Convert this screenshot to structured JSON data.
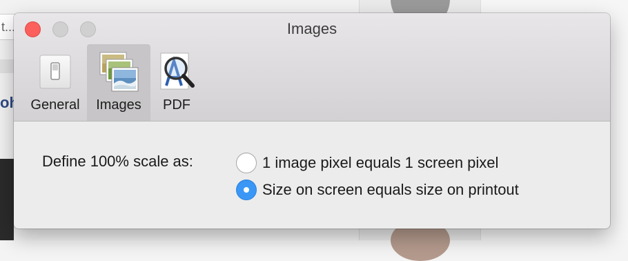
{
  "background": {
    "field_text": "t...",
    "partial_text": "oh"
  },
  "window": {
    "title": "Images",
    "traffic_lights": [
      "close",
      "minimize",
      "zoom"
    ]
  },
  "toolbar": {
    "items": [
      {
        "label": "General",
        "icon": "general-switch-icon",
        "selected": false
      },
      {
        "label": "Images",
        "icon": "images-stack-icon",
        "selected": true
      },
      {
        "label": "PDF",
        "icon": "pdf-magnifier-icon",
        "selected": false
      }
    ]
  },
  "settings": {
    "scale_label": "Define 100% scale as:",
    "options": [
      {
        "label": "1 image pixel equals 1 screen pixel",
        "checked": false
      },
      {
        "label": "Size on screen equals size on printout",
        "checked": true
      }
    ]
  },
  "colors": {
    "accent": "#3b97f6",
    "close": "#fc605c"
  }
}
